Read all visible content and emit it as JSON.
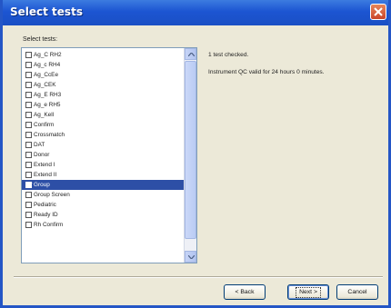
{
  "window": {
    "title": "Select tests"
  },
  "list": {
    "label": "Select tests:",
    "items": [
      {
        "label": "Ag_C RH2",
        "checked": false,
        "selected": false
      },
      {
        "label": "Ag_c RH4",
        "checked": false,
        "selected": false
      },
      {
        "label": "Ag_CcEe",
        "checked": false,
        "selected": false
      },
      {
        "label": "Ag_CEK",
        "checked": false,
        "selected": false
      },
      {
        "label": "Ag_E RH3",
        "checked": false,
        "selected": false
      },
      {
        "label": "Ag_e RH5",
        "checked": false,
        "selected": false
      },
      {
        "label": "Ag_Kell",
        "checked": false,
        "selected": false
      },
      {
        "label": "Confirm",
        "checked": false,
        "selected": false
      },
      {
        "label": "Crossmatch",
        "checked": false,
        "selected": false
      },
      {
        "label": "DAT",
        "checked": false,
        "selected": false
      },
      {
        "label": "Donor",
        "checked": false,
        "selected": false
      },
      {
        "label": "Extend I",
        "checked": false,
        "selected": false
      },
      {
        "label": "Extend II",
        "checked": false,
        "selected": false
      },
      {
        "label": "Group",
        "checked": true,
        "selected": true
      },
      {
        "label": "Group Screen",
        "checked": false,
        "selected": false
      },
      {
        "label": "Pediatric",
        "checked": false,
        "selected": false
      },
      {
        "label": "Ready ID",
        "checked": false,
        "selected": false
      },
      {
        "label": "Rh Confirm",
        "checked": false,
        "selected": false
      }
    ]
  },
  "status": {
    "tests_checked": "1 test checked.",
    "qc_message": "Instrument QC valid for 24 hours 0 minutes."
  },
  "buttons": {
    "back": "< Back",
    "next": "Next >",
    "cancel": "Cancel"
  },
  "colors": {
    "titlebar": "#1c55d2",
    "selection": "#2d4fa6",
    "dialog_bg": "#ece9d8"
  }
}
